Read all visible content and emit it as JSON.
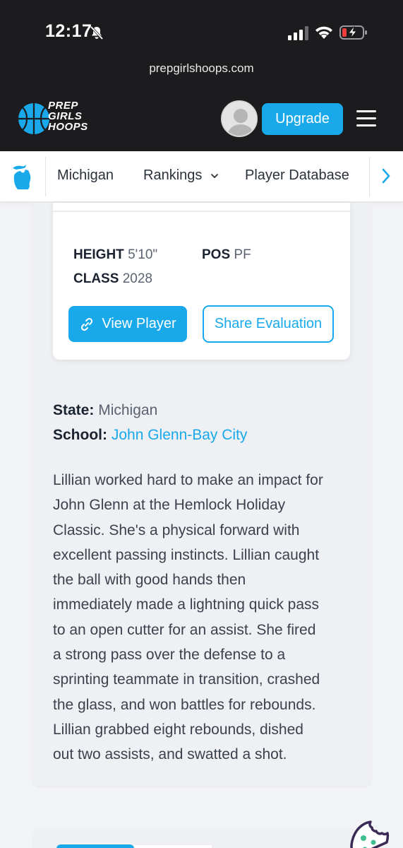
{
  "status_bar": {
    "time": "12:17"
  },
  "browser": {
    "url": "prepgirlshoops.com"
  },
  "site": {
    "logo_lines": [
      "PREP",
      "GIRLS",
      "HOOPS"
    ],
    "upgrade_label": "Upgrade"
  },
  "subnav": {
    "items": [
      "Michigan",
      "Rankings",
      "Player Database"
    ]
  },
  "player": {
    "height_label": "HEIGHT",
    "height_value": "5'10\"",
    "pos_label": "POS",
    "pos_value": "PF",
    "class_label": "CLASS",
    "class_value": "2028",
    "view_label": "View Player",
    "share_label": "Share Evaluation"
  },
  "evaluation": {
    "state_label": "State:",
    "state_value": "Michigan",
    "school_label": "School:",
    "school_value": "John Glenn-Bay City",
    "lines": [
      "Lillian worked hard to make an impact for",
      "John Glenn at the Hemlock Holiday",
      "Classic. She's a physical forward with",
      "excellent passing instincts. Lillian caught",
      "the ball with good hands then",
      "immediately made a lightning quick pass",
      "to an open cutter for an assist. She fired",
      "a strong pass over the defense to a",
      "sprinting teammate in transition, crashed",
      "the glass, and won battles for rebounds.",
      "Lillian grabbed eight rebounds, dished",
      "out two assists, and swatted a shot."
    ]
  },
  "colors": {
    "accent": "#19a9ea",
    "header_bg": "#1c1c1e",
    "page_bg": "#f2f3f5"
  },
  "icons": [
    "bell-slash-icon",
    "signal-icon",
    "wifi-icon",
    "battery-charging-icon",
    "basketball-logo-icon",
    "user-avatar-icon",
    "hamburger-menu-icon",
    "michigan-state-icon",
    "chevron-down-icon",
    "chevron-right-icon",
    "link-icon",
    "cookie-icon"
  ]
}
